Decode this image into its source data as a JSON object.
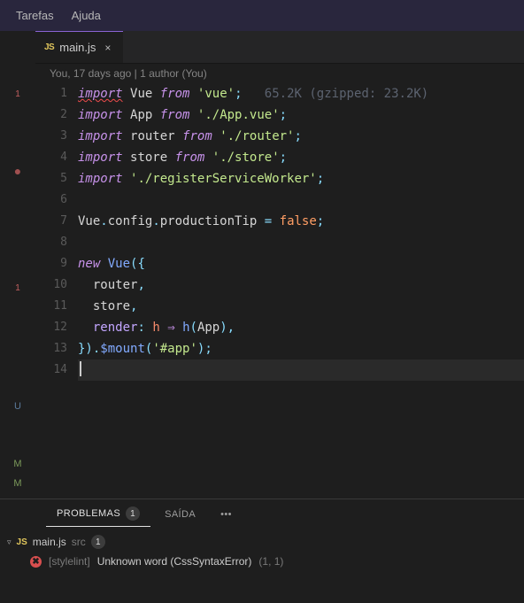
{
  "menu": {
    "tarefas": "Tarefas",
    "ajuda": "Ajuda"
  },
  "tab": {
    "icon": "JS",
    "title": "main.js",
    "close": "×"
  },
  "codelens": "You, 17 days ago | 1 author (You)",
  "lines": [
    "1",
    "2",
    "3",
    "4",
    "5",
    "6",
    "7",
    "8",
    "9",
    "10",
    "11",
    "12",
    "13",
    "14"
  ],
  "code": {
    "import": "import",
    "from": "from",
    "vue": "Vue",
    "app": "App",
    "router": "router",
    "store": "store",
    "vue_q": "'vue'",
    "app_q": "'./App.vue'",
    "router_q": "'./router'",
    "store_q": "'./store'",
    "rsw_q": "'./registerServiceWorker'",
    "hint": "65.2K (gzipped: 23.2K)",
    "config": "config",
    "productionTip": "productionTip",
    "false": "false",
    "new": "new",
    "Vue2": "Vue",
    "render": "render",
    "h": "h",
    "App2": "App",
    "mount": "$mount",
    "app_sel": "'#app'"
  },
  "panel": {
    "tab_problems": "PROBLEMAS",
    "tab_problems_count": "1",
    "tab_output": "SAÍDA",
    "more": "•••",
    "file_icon": "JS",
    "file_name": "main.js",
    "file_dir": "src",
    "file_count": "1",
    "prob_source": "[stylelint]",
    "prob_msg": "Unknown word (CssSyntaxError)",
    "prob_loc": "(1, 1)"
  },
  "gutter": {
    "err1": "1",
    "err2": "1",
    "u": "U",
    "m": "M"
  }
}
